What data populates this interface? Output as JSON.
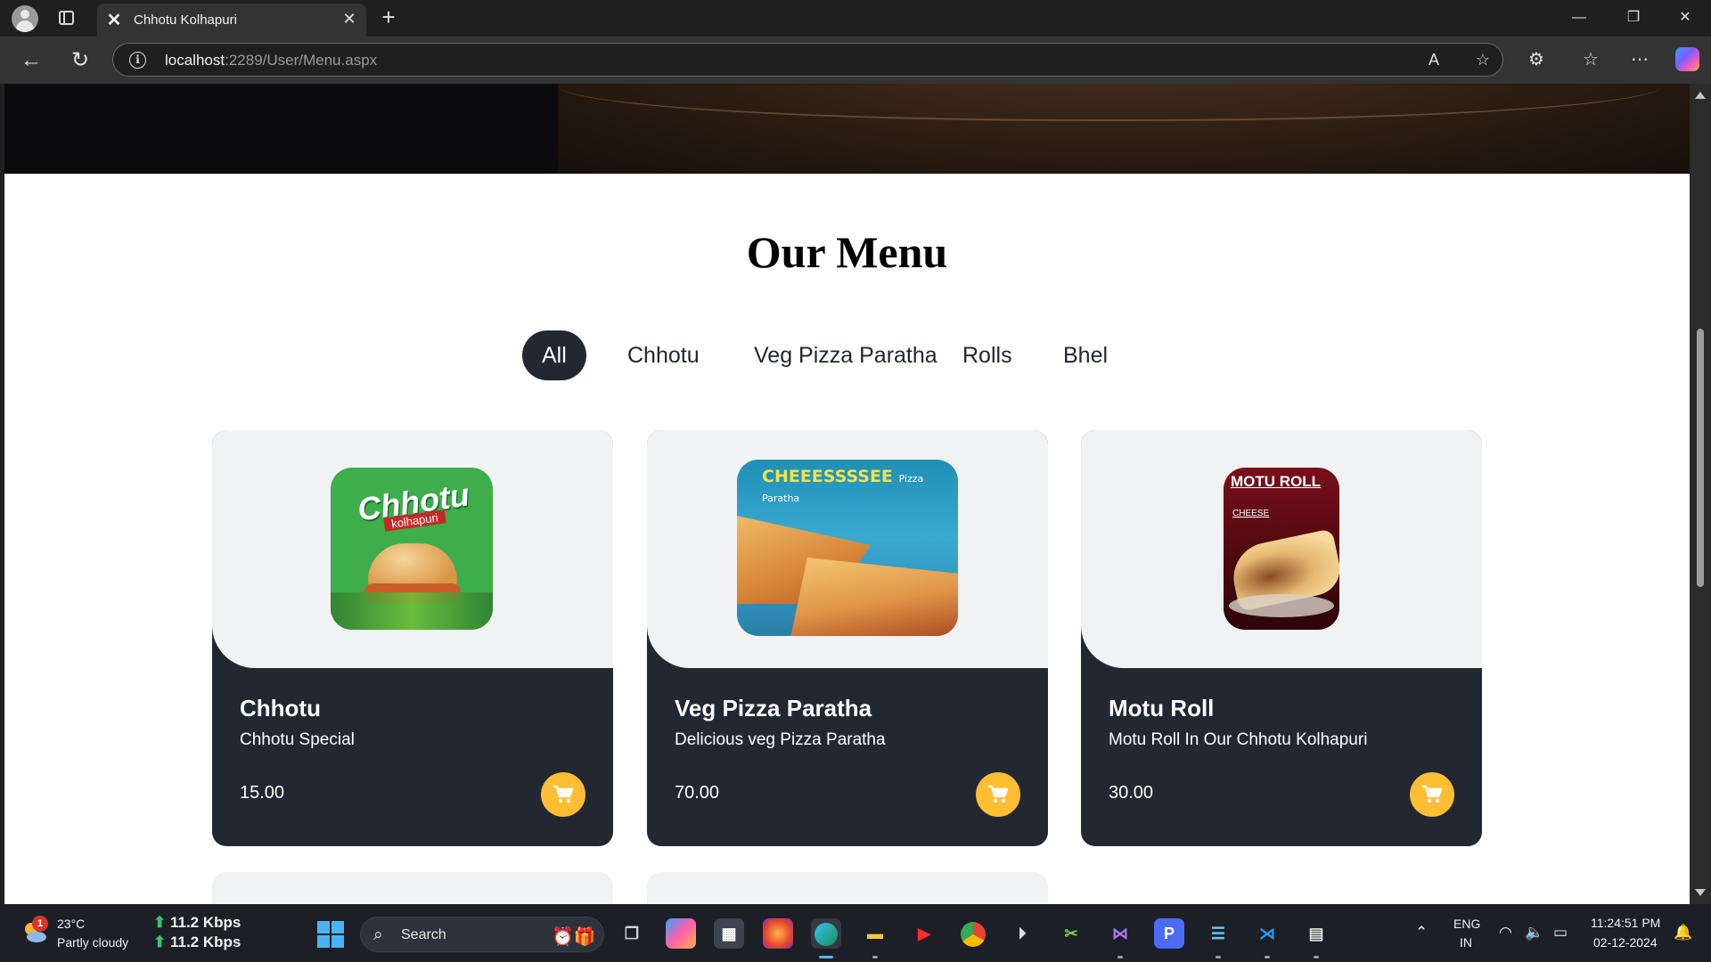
{
  "browser": {
    "tab_title": "Chhotu Kolhapuri",
    "url_host": "localhost",
    "url_rest": ":2289/User/Menu.aspx"
  },
  "page": {
    "menu_title": "Our Menu",
    "filters": [
      "All",
      "Chhotu",
      "Veg Pizza Paratha",
      "Rolls",
      "Bhel"
    ],
    "active_filter": "All",
    "items": [
      {
        "name": "Chhotu",
        "description": "Chhotu Special",
        "price": "15.00",
        "image_brand": "Chhotu",
        "image_sub": "kolhapuri"
      },
      {
        "name": "Veg Pizza Paratha",
        "description": "Delicious veg Pizza Paratha",
        "price": "70.00",
        "image_banner": "CHEEESSSSEE",
        "image_banner_sub": "Pizza Paratha"
      },
      {
        "name": "Motu Roll",
        "description": "Motu Roll In Our Chhotu Kolhapuri",
        "price": "30.00",
        "image_title": "MOTU ROLL",
        "image_sub": "CHEESE"
      }
    ],
    "accent_color": "#ffbe33",
    "card_dark": "#222831"
  },
  "taskbar": {
    "weather_badge": "1",
    "temperature": "23°C",
    "weather_desc": "Partly cloudy",
    "net_up": "11.2 Kbps",
    "net_down": "11.2 Kbps",
    "search_label": "Search",
    "lang_1": "ENG",
    "lang_2": "IN",
    "time": "11:24:51 PM",
    "date": "02-12-2024"
  }
}
